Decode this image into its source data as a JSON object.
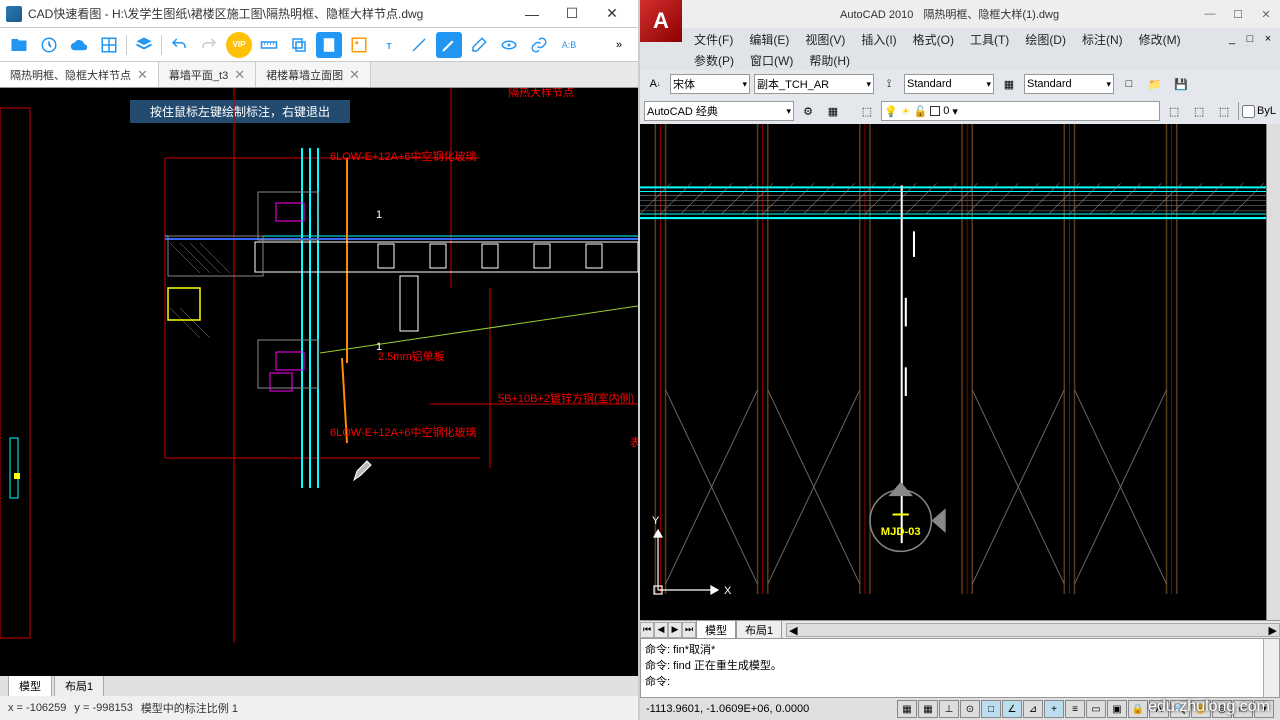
{
  "left": {
    "title": "CAD快速看图 - H:\\发学生图纸\\裙楼区施工图\\隔热明框、隐框大样节点.dwg",
    "win": {
      "min": "—",
      "max": "☐",
      "close": "✕"
    },
    "tabs": [
      {
        "label": "隔热明框、隐框大样节点",
        "close": "✕"
      },
      {
        "label": "幕墙平面_t3",
        "close": "✕"
      },
      {
        "label": "裙楼幕墙立面图",
        "close": "✕"
      }
    ],
    "hint": "按住鼠标左键绘制标注，右键退出",
    "sheets": {
      "model": "模型",
      "layout": "布局1"
    },
    "status": {
      "x": "x = -106259",
      "y": "y = -998153",
      "scale": "模型中的标注比例  1"
    },
    "dwg": {
      "labels": [
        "6LOW-E+12A+6中空钢化玻璃",
        "2.5mm铝单板",
        "5B+10B+2镀锌方钢(室内侧)",
        "6LOW-E+12A+6中空钢化玻璃"
      ]
    }
  },
  "right": {
    "app": "A",
    "title_app": "AutoCAD 2010",
    "title_file": "隔热明框、隐框大样(1).dwg",
    "win": {
      "min": "—",
      "max": "☐",
      "close": "✕"
    },
    "menu": [
      "文件(F)",
      "编辑(E)",
      "视图(V)",
      "插入(I)",
      "格式(O)",
      "工具(T)",
      "绘图(D)",
      "标注(N)",
      "修改(M)"
    ],
    "menu2": [
      "参数(P)",
      "窗口(W)",
      "帮助(H)"
    ],
    "mdi": {
      "min": "_",
      "max": "□",
      "close": "×"
    },
    "font": "宋体",
    "textstyle": "副本_TCH_AR",
    "dimstyle": "Standard",
    "tablestyle": "Standard",
    "workspace": "AutoCAD 经典",
    "layer_name": "0",
    "bylayer": "ByL",
    "tabs": {
      "model": "模型",
      "layout": "布局1"
    },
    "cmd": [
      "命令: fin*取消*",
      "命令: find 正在重生成模型。",
      "命令:"
    ],
    "status_coords": "-1113.9601, -1.0609E+06, 0.0000",
    "ucs": {
      "x": "X",
      "y": "Y"
    },
    "marker": "MJD-03"
  },
  "watermark": "edu.zhulong.com"
}
